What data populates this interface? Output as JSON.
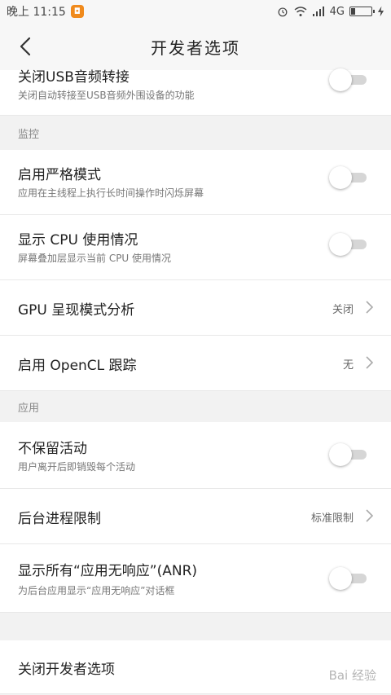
{
  "status": {
    "time": "晚上 11:15",
    "network": "4G"
  },
  "header": {
    "title": "开发者选项"
  },
  "rows": {
    "usb_audio": {
      "title": "关闭USB音频转接",
      "sub": "关闭自动转接至USB音频外围设备的功能"
    },
    "strict_mode": {
      "title": "启用严格模式",
      "sub": "应用在主线程上执行长时间操作时闪烁屏幕"
    },
    "cpu_usage": {
      "title": "显示 CPU 使用情况",
      "sub": "屏幕叠加层显示当前 CPU 使用情况"
    },
    "gpu_profile": {
      "title": "GPU 呈现模式分析",
      "value": "关闭"
    },
    "opencl": {
      "title": "启用 OpenCL 跟踪",
      "value": "无"
    },
    "no_keep": {
      "title": "不保留活动",
      "sub": "用户离开后即销毁每个活动"
    },
    "bg_limit": {
      "title": "后台进程限制",
      "value": "标准限制"
    },
    "anr": {
      "title": "显示所有“应用无响应”(ANR)",
      "sub": "为后台应用显示“应用无响应”对话框"
    },
    "close_dev": {
      "title": "关闭开发者选项"
    }
  },
  "sections": {
    "monitor": "监控",
    "apps": "应用"
  },
  "watermark": "Bai 经验"
}
